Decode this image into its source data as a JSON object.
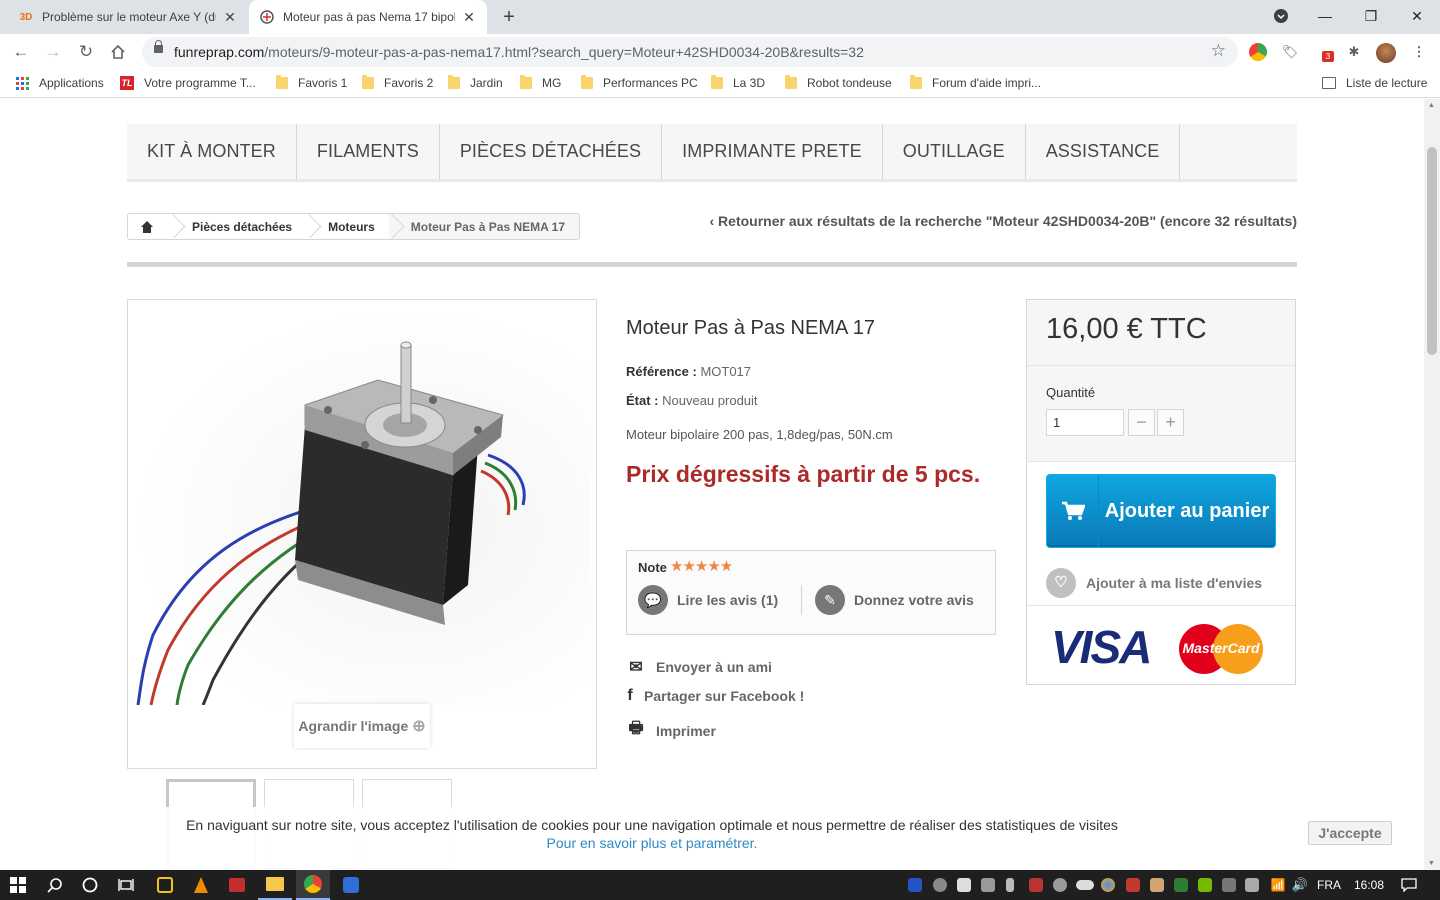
{
  "browser": {
    "tabs": [
      {
        "icon_text": "3D",
        "title": "Problème sur le moteur Axe Y (du",
        "active": false
      },
      {
        "icon_text": "",
        "title": "Moteur pas à pas Nema 17 bipol",
        "active": true
      }
    ],
    "new_tab_label": "+",
    "url_host": "funreprap.com",
    "url_path": "/moteurs/9-moteur-pas-a-pas-nema17.html?search_query=Moteur+42SHD0034-20B&results=32",
    "extension_badge": "3",
    "bookmarks": [
      {
        "label": "Applications",
        "type": "apps"
      },
      {
        "label": "Votre programme T...",
        "type": "site"
      },
      {
        "label": "Favoris 1",
        "type": "folder"
      },
      {
        "label": "Favoris 2",
        "type": "folder"
      },
      {
        "label": "Jardin",
        "type": "folder"
      },
      {
        "label": "MG",
        "type": "folder"
      },
      {
        "label": "Performances PC",
        "type": "folder"
      },
      {
        "label": "La 3D",
        "type": "folder"
      },
      {
        "label": "Robot tondeuse",
        "type": "folder"
      },
      {
        "label": "Forum d'aide impri...",
        "type": "folder"
      }
    ],
    "reading_list": "Liste de lecture"
  },
  "site": {
    "menu": [
      "Kit à monter",
      "Filaments",
      "Pièces détachées",
      "Imprimante prete",
      "Outillage",
      "Assistance"
    ],
    "breadcrumb": [
      "Pièces détachées",
      "Moteurs",
      "Moteur Pas à Pas NEMA 17"
    ],
    "back_link": "Retourner aux résultats de la recherche \"Moteur 42SHD0034-20B\" (encore 32 résultats)"
  },
  "product": {
    "title": "Moteur Pas à Pas NEMA 17",
    "reference_label": "Référence :",
    "reference_value": "MOT017",
    "condition_label": "État :",
    "condition_value": "Nouveau produit",
    "description": "Moteur bipolaire 200 pas, 1,8deg/pas, 50N.cm",
    "promo": "Prix dégressifs à partir de 5 pcs.",
    "enlarge_label": "Agrandir l'image",
    "rating": {
      "label": "Note",
      "stars": 5,
      "read_reviews": "Lire les avis (1)",
      "write_review": "Donnez votre avis"
    },
    "actions": {
      "send_friend": "Envoyer à un ami",
      "share_facebook": "Partager sur Facebook !",
      "print": "Imprimer"
    }
  },
  "buy": {
    "price": "16,00 € TTC",
    "quantity_label": "Quantité",
    "quantity_value": "1",
    "minus": "−",
    "plus": "+",
    "add_to_cart": "Ajouter au panier",
    "wishlist": "Ajouter à ma liste d'envies",
    "visa": "VISA",
    "mastercard": "MasterCard"
  },
  "cookie": {
    "message": "En naviguant sur notre site, vous acceptez l'utilisation de cookies pour une navigation optimale et nous permettre de réaliser des statistiques de visites",
    "more": "Pour en savoir plus et paramétrer.",
    "accept": "J'accepte"
  },
  "taskbar": {
    "language": "FRA",
    "time": "16:08"
  },
  "colors": {
    "accent_blue": "#0a79b7",
    "promo_red": "#ad2a2a",
    "star_orange": "#ef8743",
    "link_blue": "#2e8ac6"
  }
}
